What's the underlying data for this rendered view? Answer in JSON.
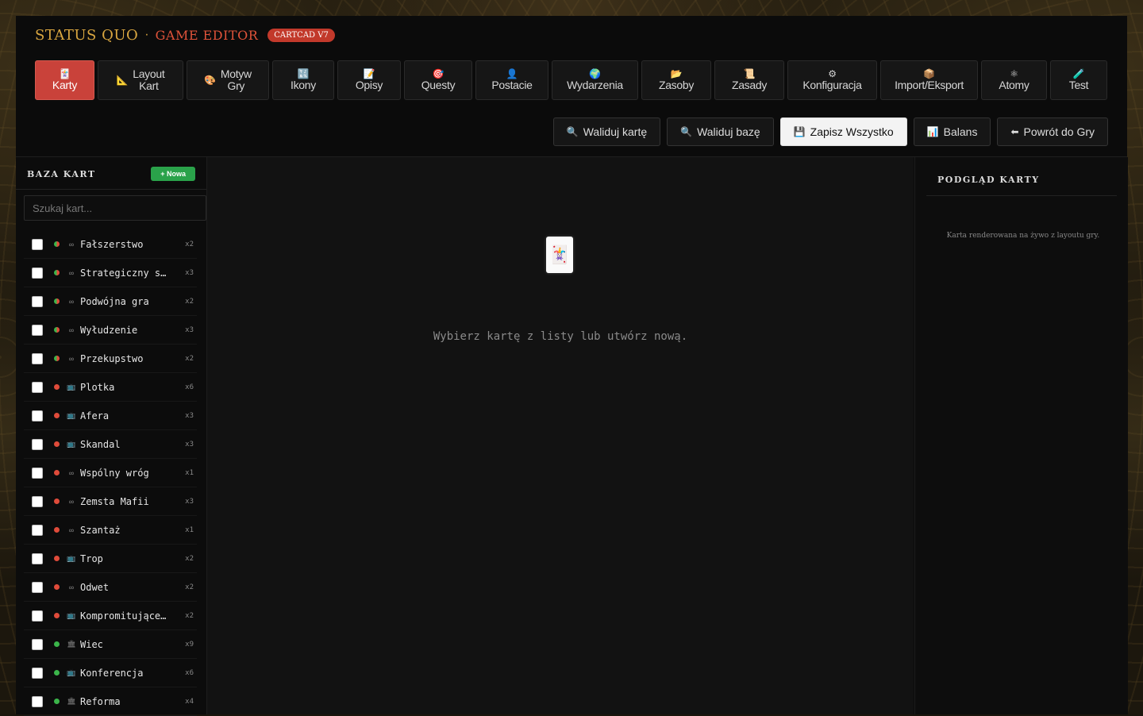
{
  "header": {
    "brand": "STATUS QUO",
    "separator": "·",
    "subtitle": "GAME EDITOR",
    "version": "CARTCAD V7"
  },
  "tabs": [
    {
      "icon": "🃏",
      "icon_name": "card-icon",
      "label": "Karty",
      "active": true
    },
    {
      "icon": "📐",
      "icon_name": "ruler-icon",
      "label": "Layout\nKart"
    },
    {
      "icon": "🎨",
      "icon_name": "palette-icon",
      "label": "Motyw\nGry"
    },
    {
      "icon": "🔣",
      "icon_name": "symbols-icon",
      "label": "Ikony"
    },
    {
      "icon": "📝",
      "icon_name": "memo-icon",
      "label": "Opisy"
    },
    {
      "icon": "🎯",
      "icon_name": "target-icon",
      "label": "Questy"
    },
    {
      "icon": "👤",
      "icon_name": "person-icon",
      "label": "Postacie"
    },
    {
      "icon": "🌍",
      "icon_name": "globe-icon",
      "label": "Wydarzenia"
    },
    {
      "icon": "📂",
      "icon_name": "folder-icon",
      "label": "Zasoby"
    },
    {
      "icon": "📜",
      "icon_name": "scroll-icon",
      "label": "Zasady"
    },
    {
      "icon": "⚙",
      "icon_name": "gear-icon",
      "label": "Konfiguracja"
    },
    {
      "icon": "📦",
      "icon_name": "package-icon",
      "label": "Import/Eksport"
    },
    {
      "icon": "⚛",
      "icon_name": "atom-icon",
      "label": "Atomy"
    },
    {
      "icon": "🧪",
      "icon_name": "test-tube-icon",
      "label": "Test"
    }
  ],
  "actions": [
    {
      "icon": "🔍",
      "icon_name": "magnifier-icon",
      "label": "Waliduj kartę"
    },
    {
      "icon": "🔍",
      "icon_name": "magnifier-icon",
      "label": "Waliduj bazę"
    },
    {
      "icon": "💾",
      "icon_name": "floppy-disk-icon",
      "label": "Zapisz Wszystko",
      "primary": true
    },
    {
      "icon": "📊",
      "icon_name": "bar-chart-icon",
      "label": "Balans"
    },
    {
      "icon": "⬅",
      "icon_name": "arrow-left-icon",
      "label": "Powrót do Gry"
    }
  ],
  "sidebar": {
    "title": "BAZA KART",
    "new_label": "+ Nowa",
    "search_placeholder": "Szukaj kart...",
    "cards": [
      {
        "name": "Fałszerstwo",
        "count": "x2",
        "dot": "#3bb54a",
        "dot2": "#e04b3a",
        "kind": "∞"
      },
      {
        "name": "Strategiczny sojusz",
        "count": "x3",
        "dot": "#3bb54a",
        "dot2": "#e04b3a",
        "kind": "∞"
      },
      {
        "name": "Podwójna gra",
        "count": "x2",
        "dot": "#3bb54a",
        "dot2": "#e04b3a",
        "kind": "∞"
      },
      {
        "name": "Wyłudzenie",
        "count": "x3",
        "dot": "#3bb54a",
        "dot2": "#e04b3a",
        "kind": "∞"
      },
      {
        "name": "Przekupstwo",
        "count": "x2",
        "dot": "#3bb54a",
        "dot2": "#e04b3a",
        "kind": "∞"
      },
      {
        "name": "Plotka",
        "count": "x6",
        "dot": "#e04b3a",
        "kind": "📺"
      },
      {
        "name": "Afera",
        "count": "x3",
        "dot": "#e04b3a",
        "kind": "📺"
      },
      {
        "name": "Skandal",
        "count": "x3",
        "dot": "#e04b3a",
        "kind": "📺"
      },
      {
        "name": "Wspólny wróg",
        "count": "x1",
        "dot": "#e04b3a",
        "kind": "∞"
      },
      {
        "name": "Zemsta Mafii",
        "count": "x3",
        "dot": "#e04b3a",
        "kind": "∞"
      },
      {
        "name": "Szantaż",
        "count": "x1",
        "dot": "#e04b3a",
        "kind": "∞"
      },
      {
        "name": "Trop",
        "count": "x2",
        "dot": "#e04b3a",
        "kind": "📺"
      },
      {
        "name": "Odwet",
        "count": "x2",
        "dot": "#e04b3a",
        "kind": "∞"
      },
      {
        "name": "Kompromitujące nagranie",
        "count": "x2",
        "dot": "#e04b3a",
        "kind": "📺"
      },
      {
        "name": "Wiec",
        "count": "x9",
        "dot": "#3bb54a",
        "kind": "🏛"
      },
      {
        "name": "Konferencja",
        "count": "x6",
        "dot": "#3bb54a",
        "kind": "📺"
      },
      {
        "name": "Reforma",
        "count": "x4",
        "dot": "#3bb54a",
        "kind": "🏛"
      }
    ]
  },
  "main": {
    "empty_icon": "🃏",
    "empty_text": "Wybierz kartę z listy lub utwórz nową."
  },
  "preview": {
    "title": "PODGLĄD KARTY",
    "text": "Karta renderowana na żywo z layoutu gry."
  }
}
